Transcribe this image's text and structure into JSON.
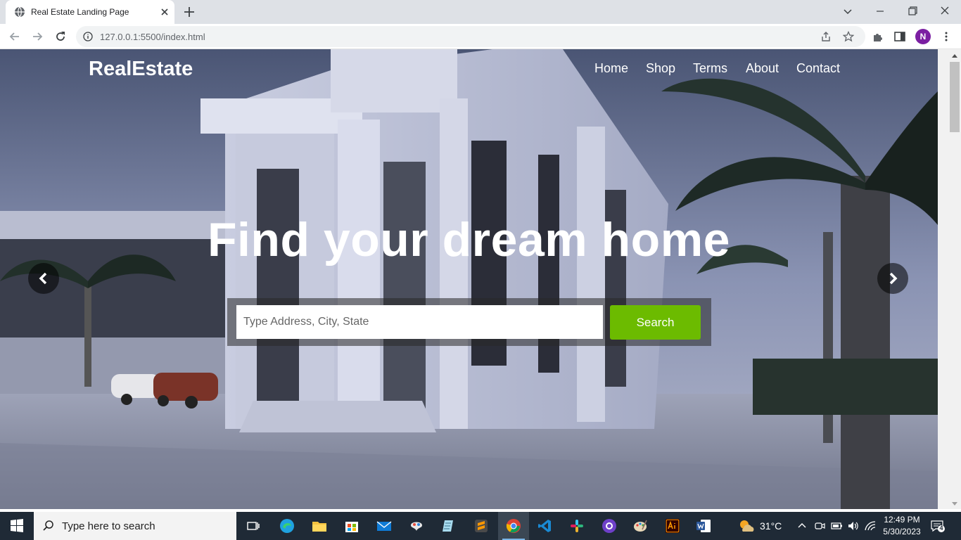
{
  "browser": {
    "tab_title": "Real Estate Landing Page",
    "url": "127.0.0.1:5500/index.html",
    "profile_initial": "N"
  },
  "site": {
    "brand": "RealEstate",
    "nav": [
      "Home",
      "Shop",
      "Terms",
      "About",
      "Contact"
    ],
    "headline": "Find your dream home",
    "search_placeholder": "Type Address, City, State",
    "search_button": "Search",
    "accent_color": "#6cbb00"
  },
  "taskbar": {
    "search_placeholder": "Type here to search",
    "apps": [
      "task-view",
      "edge",
      "file-explorer",
      "microsoft-store",
      "mail",
      "paint-3d",
      "notepad",
      "sublime-text",
      "chrome",
      "vscode",
      "slack",
      "github-desktop",
      "paint",
      "illustrator",
      "word"
    ],
    "active_app": "chrome",
    "temperature": "31°C",
    "time": "12:49 PM",
    "date": "5/30/2023",
    "notification_count": "4"
  }
}
